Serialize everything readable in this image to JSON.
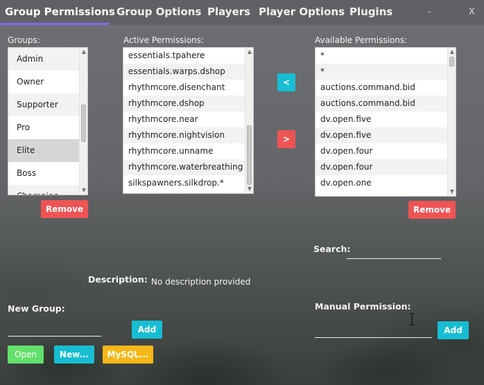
{
  "tabs": [
    {
      "label": "Group Permissions",
      "active": true
    },
    {
      "label": "Group Options",
      "active": false
    },
    {
      "label": "Players",
      "active": false
    },
    {
      "label": "Player Options",
      "active": false
    },
    {
      "label": "Plugins",
      "active": false
    }
  ],
  "window": {
    "minimize": "-",
    "close": "X"
  },
  "groups": {
    "label": "Groups:",
    "items": [
      "Admin",
      "Owner",
      "Supporter",
      "Pro",
      "Elite",
      "Boss",
      "Champion"
    ],
    "selected": "Elite",
    "remove_label": "Remove"
  },
  "active_permissions": {
    "label": "Active Permissions:",
    "items": [
      "essentials.tpahere",
      "essentials.warps.dshop",
      "rhythmcore.disenchant",
      "rhythmcore.dshop",
      "rhythmcore.near",
      "rhythmcore.nightvision",
      "rhythmcore.unname",
      "rhythmcore.waterbreathing",
      "silkspawners.silkdrop.*"
    ]
  },
  "transfer": {
    "add_label": "<",
    "remove_label": ">"
  },
  "available_permissions": {
    "label": "Available Permissions:",
    "items": [
      "*",
      "*",
      "auctions.command.bid",
      "auctions.command.bid",
      "dv.open.five",
      "dv.open.five",
      "dv.open.four",
      "dv.open.four",
      "dv.open.one"
    ],
    "remove_label": "Remove"
  },
  "search": {
    "label": "Search:",
    "value": ""
  },
  "description": {
    "label": "Description:",
    "value": "No description provided"
  },
  "new_group": {
    "label": "New Group:",
    "value": "",
    "add_label": "Add"
  },
  "manual_permission": {
    "label": "Manual Permission:",
    "value": "",
    "add_label": "Add"
  },
  "bottom_buttons": {
    "open": "Open",
    "new": "New...",
    "mysql": "MySQL..."
  },
  "colors": {
    "accent_tab": "#7c6cf2",
    "remove": "#ef5454",
    "action": "#17bed3",
    "open": "#63e06b",
    "mysql": "#f7b716"
  }
}
